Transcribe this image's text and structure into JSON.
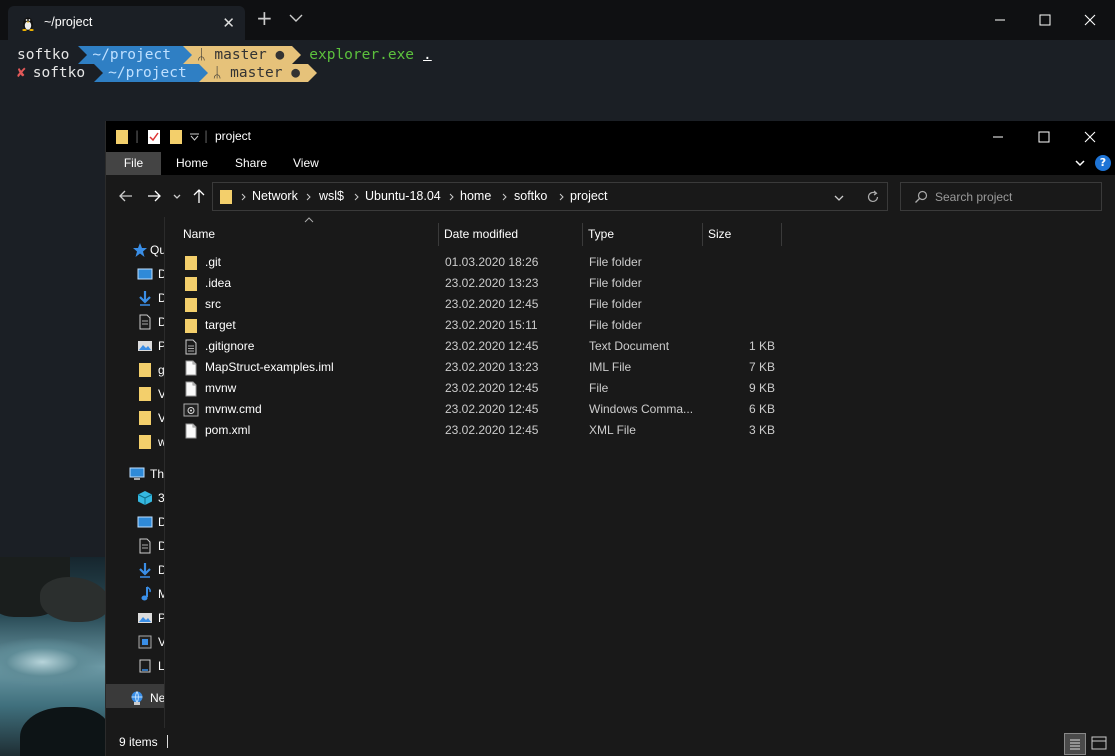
{
  "terminal": {
    "tab_title": "~/project",
    "icons": {
      "tab": "tux-icon",
      "new_tab": "plus-icon",
      "dropdown": "chevron-down-icon"
    },
    "lines": [
      {
        "user": "softko",
        "path": "~/project",
        "branch_glyph": "ᛦ",
        "branch": "master",
        "dirty": "●",
        "command": "explorer.exe",
        "arg": "."
      },
      {
        "status": "✘",
        "user": "softko",
        "path": "~/project",
        "branch_glyph": "ᛦ",
        "branch": "master",
        "dirty": "●"
      }
    ],
    "colors": {
      "background": "#1b1f25",
      "path_segment": "#2f7fc4",
      "git_segment": "#e6c27a",
      "command": "#5cc13d",
      "error": "#e35959"
    }
  },
  "explorer": {
    "title": "project",
    "ribbon": {
      "file": "File",
      "home": "Home",
      "share": "Share",
      "view": "View",
      "help": "?"
    },
    "address": {
      "crumbs": [
        "Network",
        "wsl$",
        "Ubuntu-18.04",
        "home",
        "softko",
        "project"
      ]
    },
    "search": {
      "placeholder": "Search project"
    },
    "nav_pane": [
      {
        "icon": "star-icon",
        "label": "Qu"
      },
      {
        "icon": "desktop-icon",
        "label": "D"
      },
      {
        "icon": "download-icon",
        "label": "D"
      },
      {
        "icon": "document-icon",
        "label": "D"
      },
      {
        "icon": "picture-icon",
        "label": "P"
      },
      {
        "icon": "folder-icon",
        "label": "g"
      },
      {
        "icon": "folder-icon",
        "label": "V"
      },
      {
        "icon": "folder-icon",
        "label": "V"
      },
      {
        "icon": "folder-icon",
        "label": "w"
      },
      {
        "icon": "this-pc-icon",
        "label": "Th"
      },
      {
        "icon": "3d-objects-icon",
        "label": "3"
      },
      {
        "icon": "desktop-icon",
        "label": "D"
      },
      {
        "icon": "document-icon",
        "label": "D"
      },
      {
        "icon": "download-icon",
        "label": "D"
      },
      {
        "icon": "music-icon",
        "label": "M"
      },
      {
        "icon": "picture-icon",
        "label": "P"
      },
      {
        "icon": "video-icon",
        "label": "V"
      },
      {
        "icon": "drive-icon",
        "label": "L"
      },
      {
        "icon": "network-icon",
        "label": "Ne"
      }
    ],
    "columns": {
      "name": "Name",
      "date": "Date modified",
      "type": "Type",
      "size": "Size"
    },
    "files": [
      {
        "icon": "folder-icon",
        "name": ".git",
        "date": "01.03.2020 18:26",
        "type": "File folder",
        "size": ""
      },
      {
        "icon": "folder-icon",
        "name": ".idea",
        "date": "23.02.2020 13:23",
        "type": "File folder",
        "size": ""
      },
      {
        "icon": "folder-icon",
        "name": "src",
        "date": "23.02.2020 12:45",
        "type": "File folder",
        "size": ""
      },
      {
        "icon": "folder-icon",
        "name": "target",
        "date": "23.02.2020 15:11",
        "type": "File folder",
        "size": ""
      },
      {
        "icon": "text-file-icon",
        "name": ".gitignore",
        "date": "23.02.2020 12:45",
        "type": "Text Document",
        "size": "1 KB"
      },
      {
        "icon": "file-icon",
        "name": "MapStruct-examples.iml",
        "date": "23.02.2020 13:23",
        "type": "IML File",
        "size": "7 KB"
      },
      {
        "icon": "file-icon",
        "name": "mvnw",
        "date": "23.02.2020 12:45",
        "type": "File",
        "size": "9 KB"
      },
      {
        "icon": "cmd-file-icon",
        "name": "mvnw.cmd",
        "date": "23.02.2020 12:45",
        "type": "Windows Comma...",
        "size": "6 KB"
      },
      {
        "icon": "file-icon",
        "name": "pom.xml",
        "date": "23.02.2020 12:45",
        "type": "XML File",
        "size": "3 KB"
      }
    ],
    "status": {
      "count": "9 items"
    },
    "colors": {
      "window": "#191919",
      "titlebar": "#000000",
      "folder": "#f3cf6b",
      "accent": "#1e74d6"
    }
  }
}
